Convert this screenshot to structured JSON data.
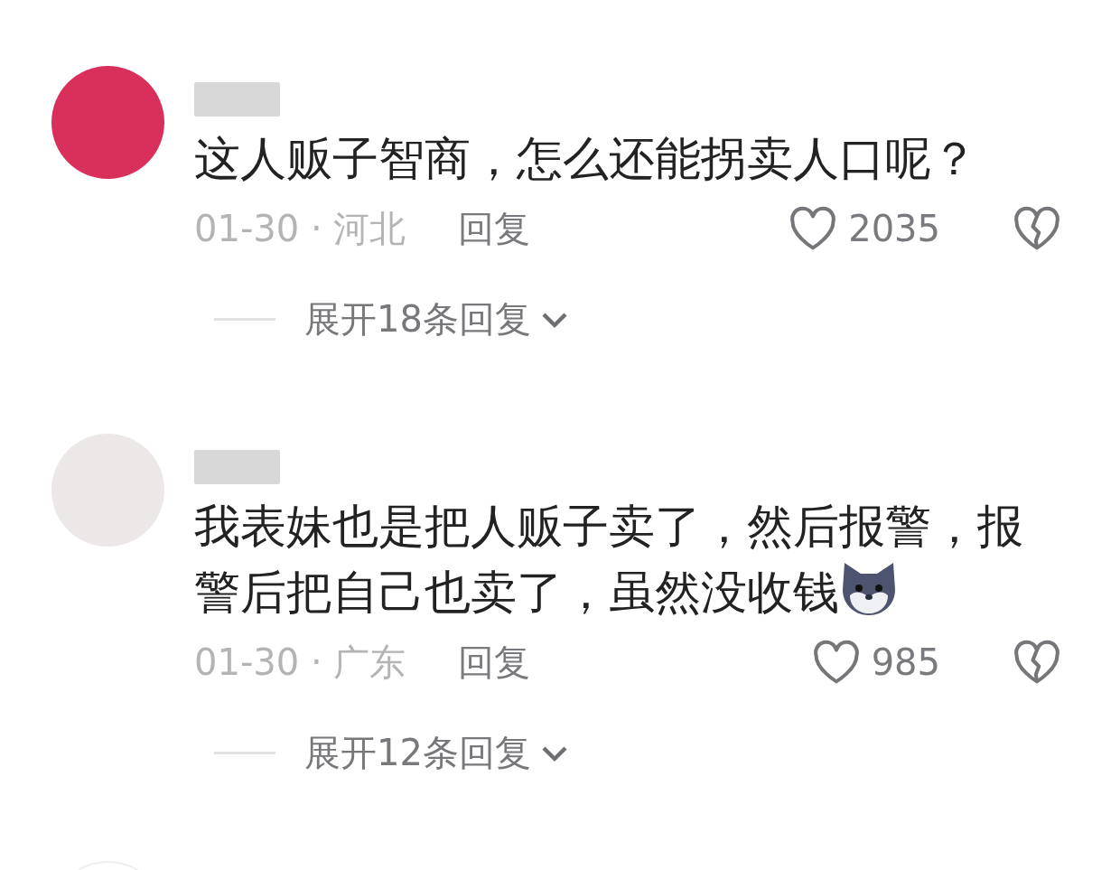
{
  "comments": [
    {
      "text": "这人贩子智商，怎么还能拐卖人口呢？",
      "sticker": false,
      "date_location": "01-30 · 河北",
      "reply_label": "回复",
      "likes": "2035",
      "expand_label": "展开18条回复"
    },
    {
      "text": "我表妹也是把人贩子卖了，然后报警，报警后把自己也卖了，虽然没收钱",
      "sticker": true,
      "date_location": "01-30 · 广东",
      "reply_label": "回复",
      "likes": "985",
      "expand_label": "展开12条回复"
    }
  ]
}
